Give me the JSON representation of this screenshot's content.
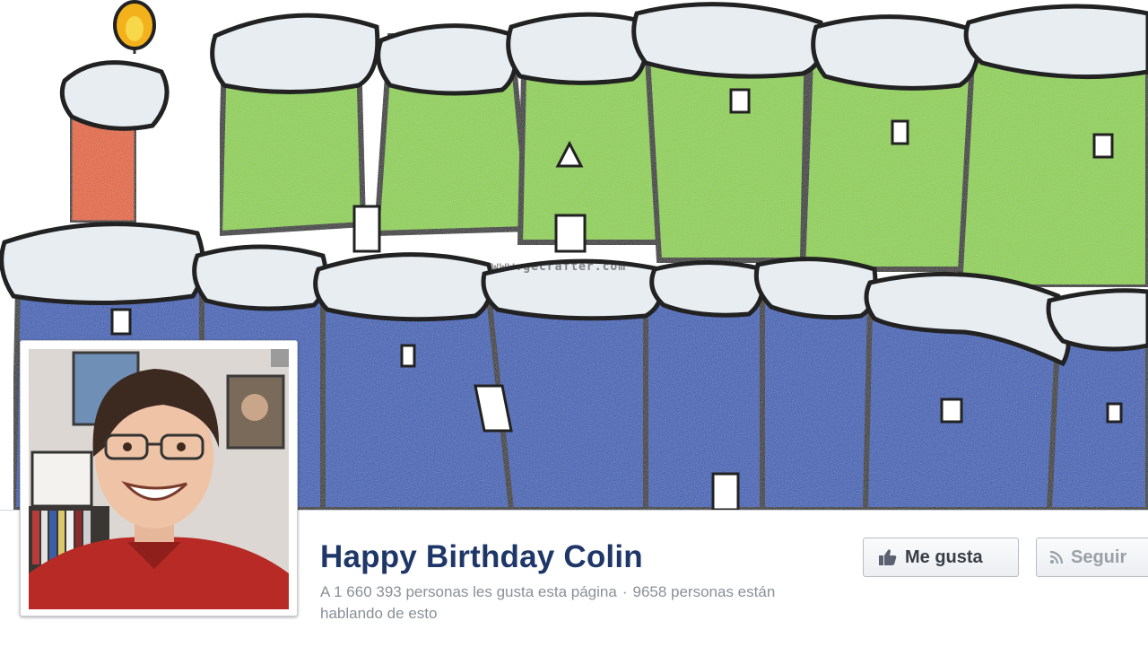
{
  "cover": {
    "graphic_text": "HAPPY BIRTHDAY",
    "watermark": "www.gecrafter.com"
  },
  "page": {
    "title": "Happy Birthday Colin",
    "likes_text": "A 1 660 393 personas les gusta esta página",
    "separator": "·",
    "talking_text": "9658 personas están hablando de esto"
  },
  "actions": {
    "like_label": "Me gusta",
    "like_icon": "thumbs-up-icon",
    "follow_label": "Seguir",
    "follow_icon": "rss-icon"
  },
  "colors": {
    "title": "#1f3768",
    "stats": "#8a8f98",
    "letters_top": "#8fd44a",
    "letters_bottom": "#2d5bb8",
    "snow": "#e8edf2",
    "candle": "#e8612a"
  }
}
